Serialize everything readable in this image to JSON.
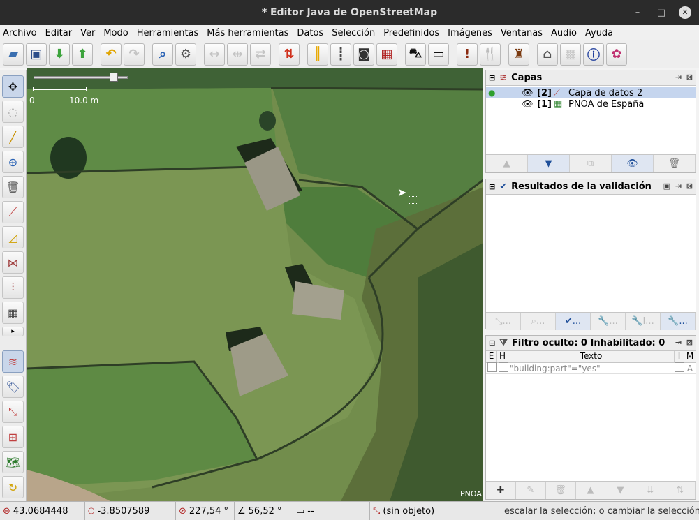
{
  "window": {
    "title": "* Editor Java de OpenStreetMap"
  },
  "menus": [
    "Archivo",
    "Editar",
    "Ver",
    "Modo",
    "Herramientas",
    "Más herramientas",
    "Datos",
    "Selección",
    "Predefinidos",
    "Imágenes",
    "Ventanas",
    "Audio",
    "Ayuda"
  ],
  "map": {
    "scale_zero": "0",
    "scale_label": "10.0 m",
    "attribution": "PNOA"
  },
  "layers_panel": {
    "title": "Capas",
    "layers": [
      {
        "index": "[2]",
        "name": "Capa de datos 2"
      },
      {
        "index": "[1]",
        "name": "PNOA de España"
      }
    ]
  },
  "validation_panel": {
    "title": "Resultados de la validación",
    "buttons": [
      "...",
      "...",
      "...",
      "...",
      "I...",
      "..."
    ]
  },
  "filter_panel": {
    "title": "Filtro oculto: 0 Inhabilitado: 0",
    "col_e": "E",
    "col_h": "H",
    "col_text": "Texto",
    "col_i": "I",
    "col_m": "M",
    "rows": [
      {
        "text": "\"building:part\"=\"yes\"",
        "m": "A"
      }
    ]
  },
  "status": {
    "lat": "43.0684448",
    "lon": "-3.8507589",
    "heading": "227,54 °",
    "angle": "56,52 °",
    "distance": "--",
    "selection": "(sin objeto)",
    "help": "escalar la selección; o cambiar la selección"
  }
}
